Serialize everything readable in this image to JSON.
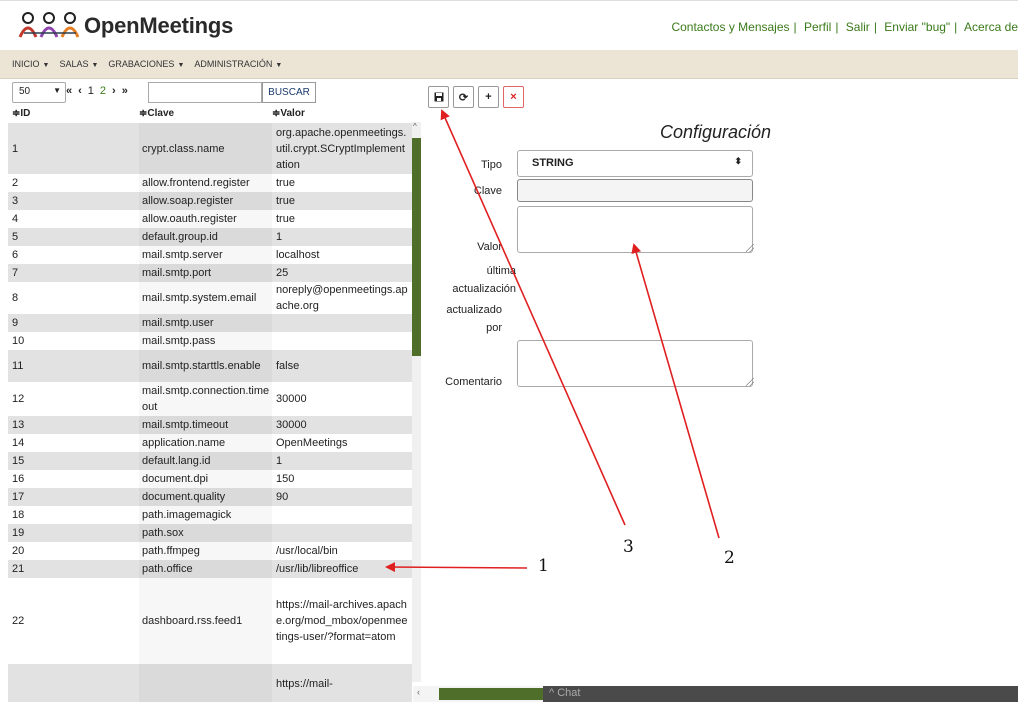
{
  "app": {
    "logo_text": "OpenMeetings",
    "top_links": [
      "Contactos y Mensajes",
      "Perfil",
      "Salir",
      "Enviar \"bug\"",
      "Acerca de"
    ]
  },
  "menu": [
    "INICIO",
    "SALAS",
    "GRABACIONES",
    "ADMINISTRACIÓN"
  ],
  "grid": {
    "page_size": "50",
    "pager": {
      "first": "«",
      "prev": "‹",
      "current": "1",
      "next_page": "2",
      "next": "›",
      "last": "»"
    },
    "search_placeholder": "",
    "search_button": "BUSCAR",
    "columns": [
      "≑ID",
      "≑Clave",
      "≑Valor"
    ],
    "rows": [
      {
        "id": "1",
        "key": "crypt.class.name",
        "value": "org.apache.openmeetings.util.crypt.SCryptImplementation"
      },
      {
        "id": "2",
        "key": "allow.frontend.register",
        "value": "true"
      },
      {
        "id": "3",
        "key": "allow.soap.register",
        "value": "true"
      },
      {
        "id": "4",
        "key": "allow.oauth.register",
        "value": "true"
      },
      {
        "id": "5",
        "key": "default.group.id",
        "value": "1"
      },
      {
        "id": "6",
        "key": "mail.smtp.server",
        "value": "localhost"
      },
      {
        "id": "7",
        "key": "mail.smtp.port",
        "value": "25"
      },
      {
        "id": "8",
        "key": "mail.smtp.system.email",
        "value": "noreply@openmeetings.apache.org"
      },
      {
        "id": "9",
        "key": "mail.smtp.user",
        "value": ""
      },
      {
        "id": "10",
        "key": "mail.smtp.pass",
        "value": ""
      },
      {
        "id": "11",
        "key": "mail.smtp.starttls.enable",
        "value": "false"
      },
      {
        "id": "12",
        "key": "mail.smtp.connection.timeout",
        "value": "30000"
      },
      {
        "id": "13",
        "key": "mail.smtp.timeout",
        "value": "30000"
      },
      {
        "id": "14",
        "key": "application.name",
        "value": "OpenMeetings"
      },
      {
        "id": "15",
        "key": "default.lang.id",
        "value": "1"
      },
      {
        "id": "16",
        "key": "document.dpi",
        "value": "150"
      },
      {
        "id": "17",
        "key": "document.quality",
        "value": "90"
      },
      {
        "id": "18",
        "key": "path.imagemagick",
        "value": ""
      },
      {
        "id": "19",
        "key": "path.sox",
        "value": ""
      },
      {
        "id": "20",
        "key": "path.ffmpeg",
        "value": "/usr/local/bin"
      },
      {
        "id": "21",
        "key": "path.office",
        "value": "/usr/lib/libreoffice"
      },
      {
        "id": "22",
        "key": "dashboard.rss.feed1",
        "value": "https://mail-archives.apache.org/mod_mbox/openmeetings-user/?format=atom"
      },
      {
        "id": "",
        "key": "",
        "value": "https://mail-"
      }
    ]
  },
  "form": {
    "title": "Configuración",
    "labels": {
      "tipo": "Tipo",
      "clave": "Clave",
      "valor": "Valor",
      "ultima_1": "última",
      "ultima_2": "actualización",
      "actualizado_1": "actualizado",
      "actualizado_2": "por",
      "comentario": "Comentario"
    },
    "tipo_value": "STRING",
    "clave_value": "",
    "valor_value": "",
    "comentario_value": ""
  },
  "chat": {
    "label": "Chat"
  },
  "annotations": {
    "n1": "1",
    "n2": "2",
    "n3": "3",
    "color": "#e02020"
  }
}
